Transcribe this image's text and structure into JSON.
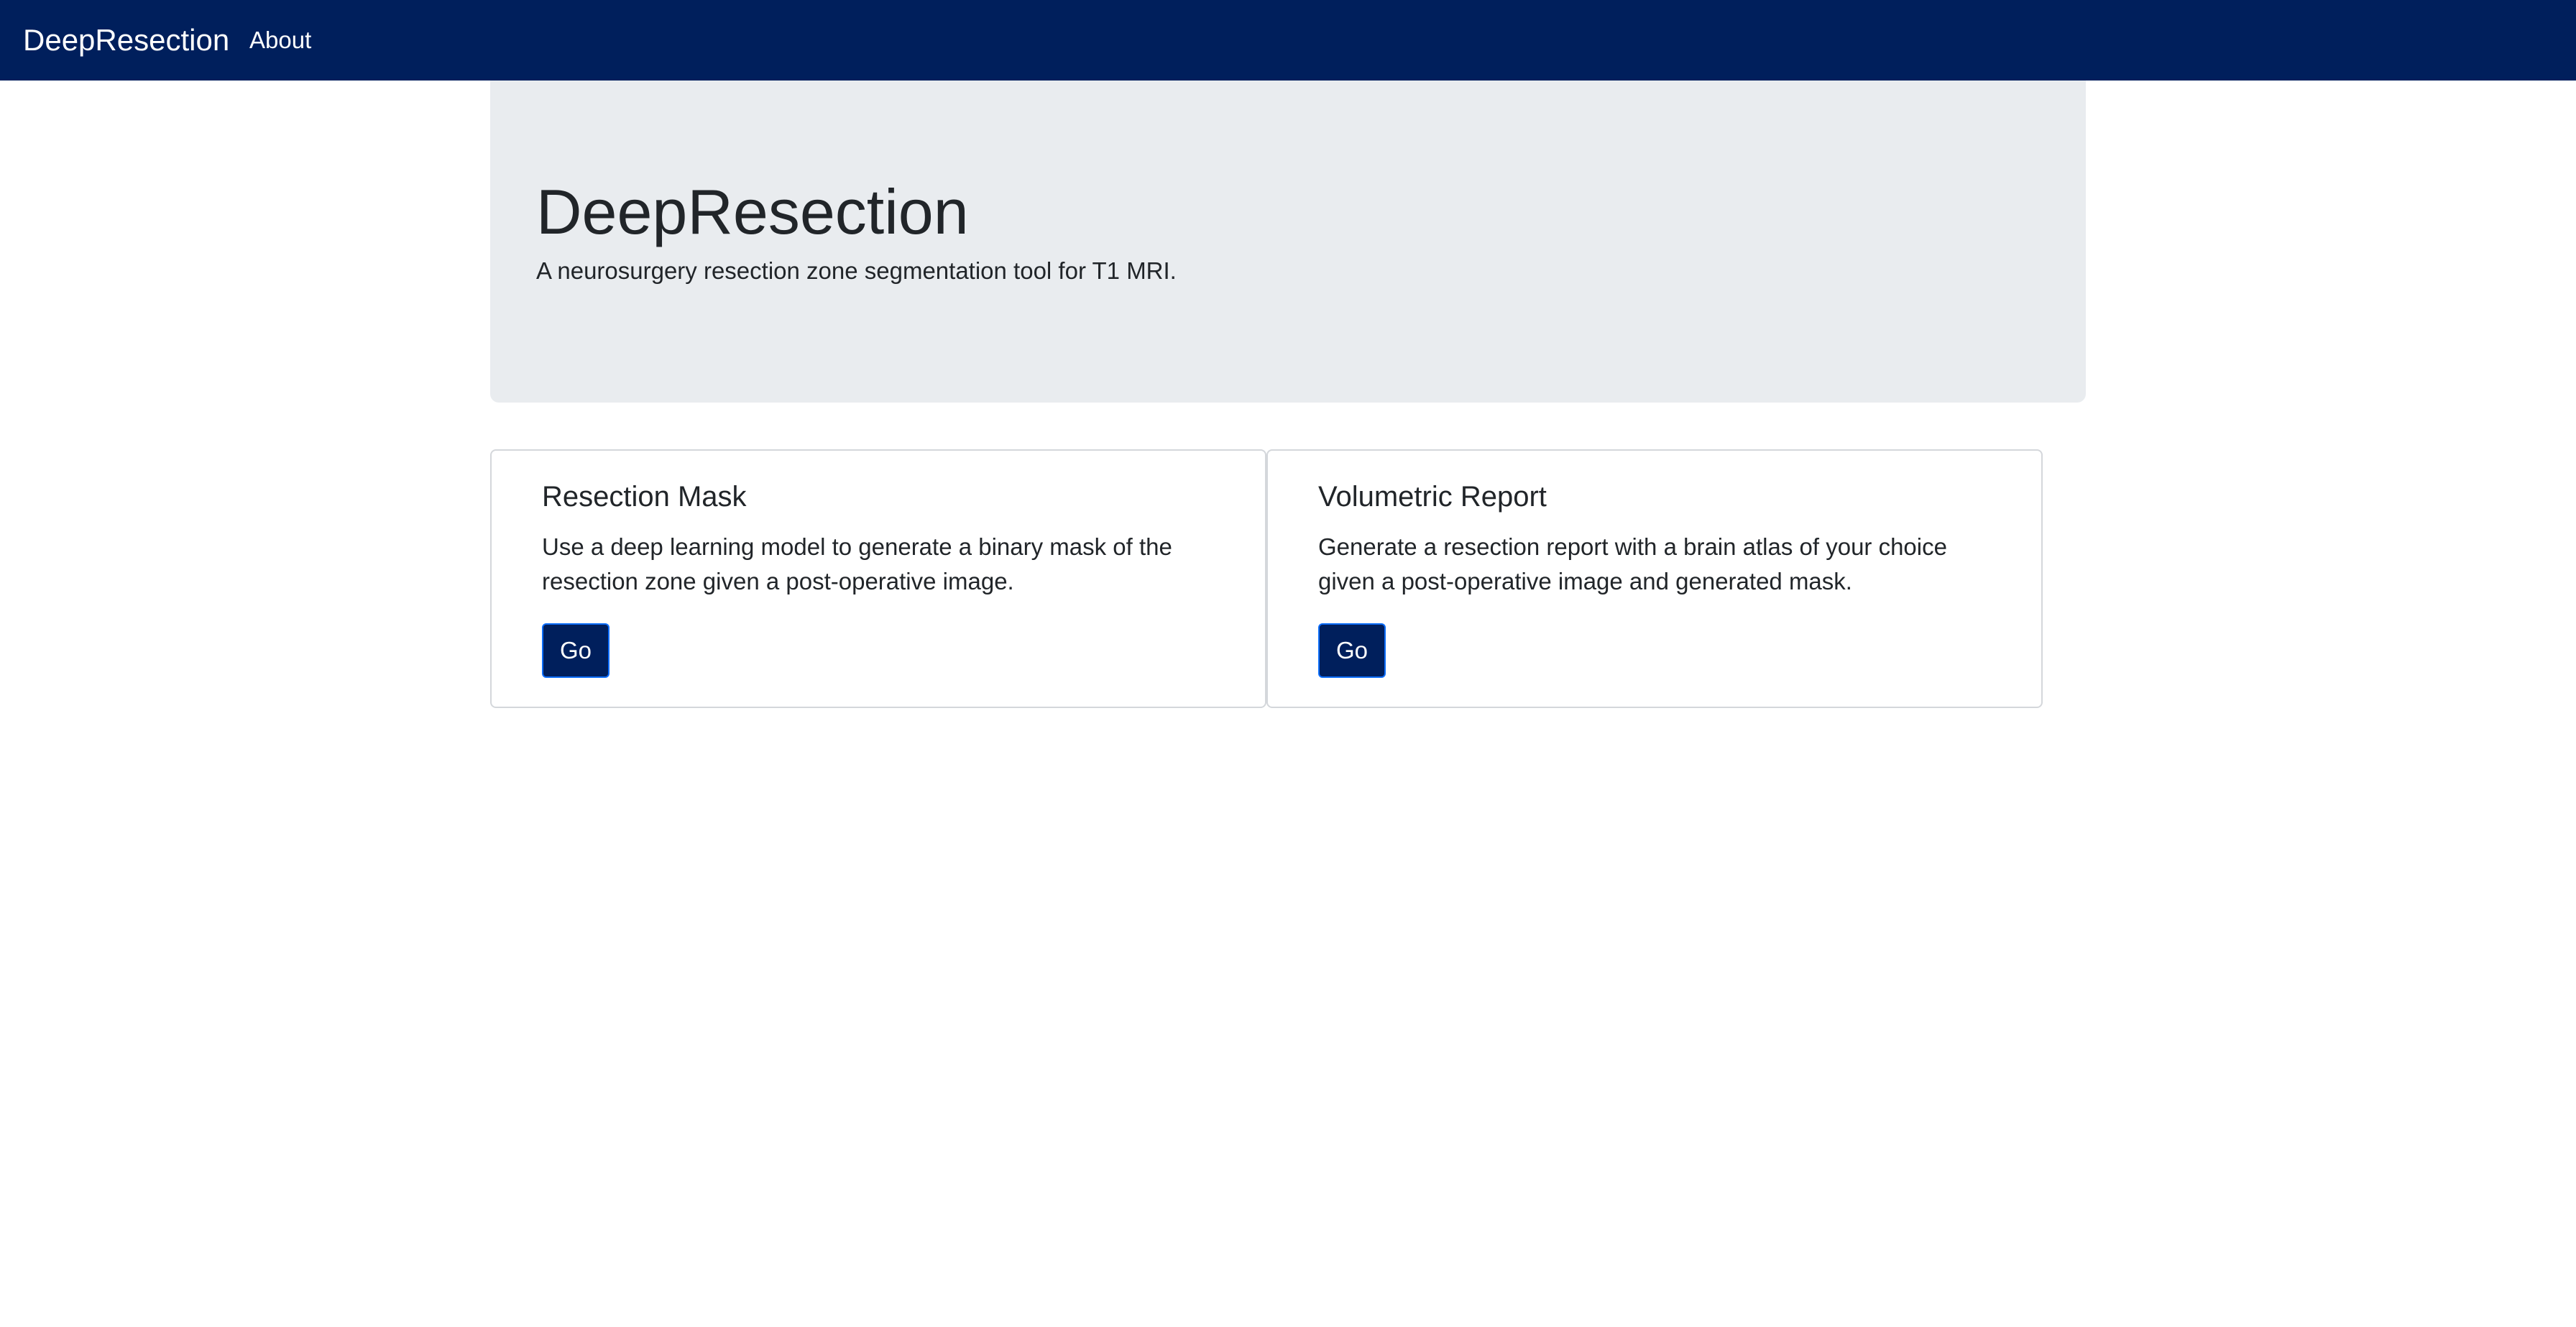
{
  "navbar": {
    "brand": "DeepResection",
    "links": [
      {
        "label": "About"
      }
    ],
    "background_color": "#001f5c"
  },
  "jumbotron": {
    "title": "DeepResection",
    "lead": "A neurosurgery resection zone segmentation tool for T1 MRI."
  },
  "cards": [
    {
      "title": "Resection Mask",
      "text": "Use a deep learning model to generate a binary mask of the resection zone given a post-operative image.",
      "button_label": "Go"
    },
    {
      "title": "Volumetric Report",
      "text": "Generate a resection report with a brain atlas of your choice given a post-operative image and generated mask.",
      "button_label": "Go"
    }
  ]
}
